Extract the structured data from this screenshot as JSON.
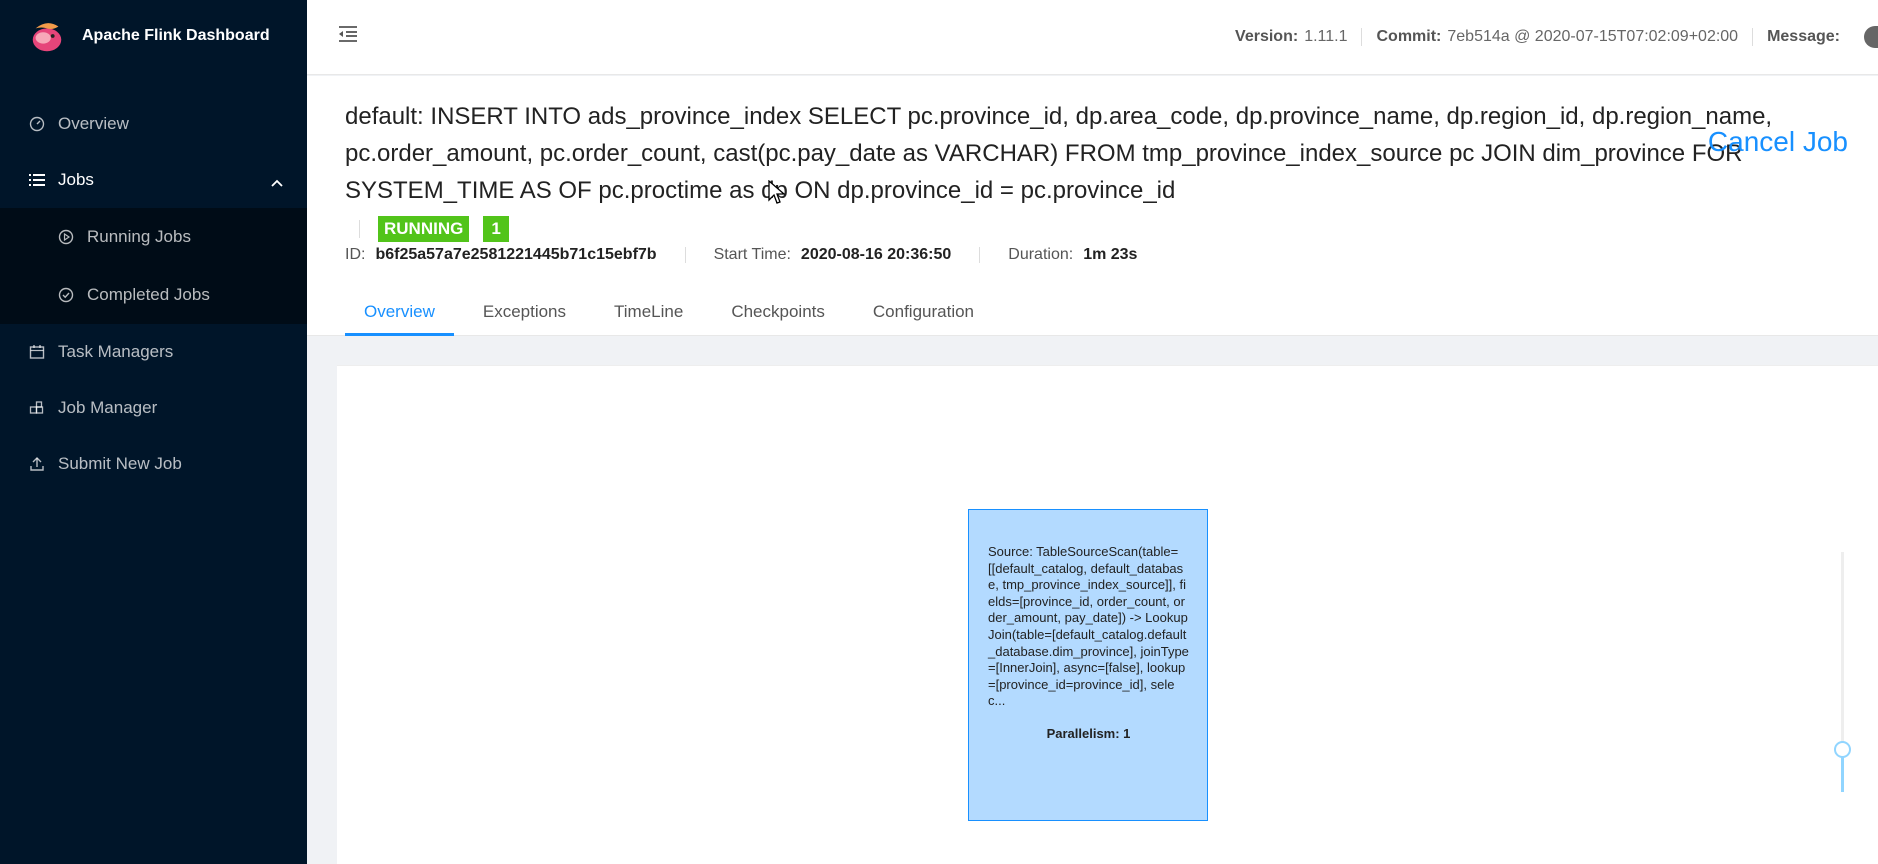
{
  "app": {
    "title": "Apache Flink Dashboard"
  },
  "sidebar": {
    "items": [
      {
        "label": "Overview",
        "icon": "dashboard-icon"
      },
      {
        "label": "Jobs",
        "icon": "list-icon"
      },
      {
        "label": "Task Managers",
        "icon": "calendar-icon"
      },
      {
        "label": "Job Manager",
        "icon": "build-icon"
      },
      {
        "label": "Submit New Job",
        "icon": "upload-icon"
      }
    ],
    "jobs_submenu": [
      {
        "label": "Running Jobs",
        "icon": "play-circle-icon"
      },
      {
        "label": "Completed Jobs",
        "icon": "check-circle-icon"
      }
    ]
  },
  "header": {
    "version_label": "Version:",
    "version_value": "1.11.1",
    "commit_label": "Commit:",
    "commit_value": "7eb514a @ 2020-07-15T07:02:09+02:00",
    "message_label": "Message:"
  },
  "job": {
    "title": "default: INSERT INTO ads_province_index SELECT pc.province_id, dp.area_code, dp.province_name, dp.region_id, dp.region_name, pc.order_amount, pc.order_count, cast(pc.pay_date as VARCHAR) FROM tmp_province_index_source pc JOIN dim_province FOR SYSTEM_TIME AS OF pc.proctime as dp ON dp.province_id = pc.province_id",
    "cancel_label": "Cancel Job",
    "status": "RUNNING",
    "task_count": "1",
    "id_label": "ID:",
    "id_value": "b6f25a57a7e2581221445b71c15ebf7b",
    "start_label": "Start Time:",
    "start_value": "2020-08-16 20:36:50",
    "duration_label": "Duration:",
    "duration_value": "1m 23s",
    "status_color": "#52c41a"
  },
  "tabs": [
    "Overview",
    "Exceptions",
    "TimeLine",
    "Checkpoints",
    "Configuration"
  ],
  "graph": {
    "node_text": "Source: TableSourceScan(table=[[default_catalog, default_database, tmp_province_index_source]], fields=[province_id, order_count, order_amount, pay_date]) -> LookupJoin(table=[default_catalog.default_database.dim_province], joinType=[InnerJoin], async=[false], lookup=[province_id=province_id], selec...",
    "parallelism": "Parallelism: 1"
  },
  "colors": {
    "sidebar_bg": "#001529",
    "accent": "#1890ff",
    "node_bg": "#b3daff"
  }
}
